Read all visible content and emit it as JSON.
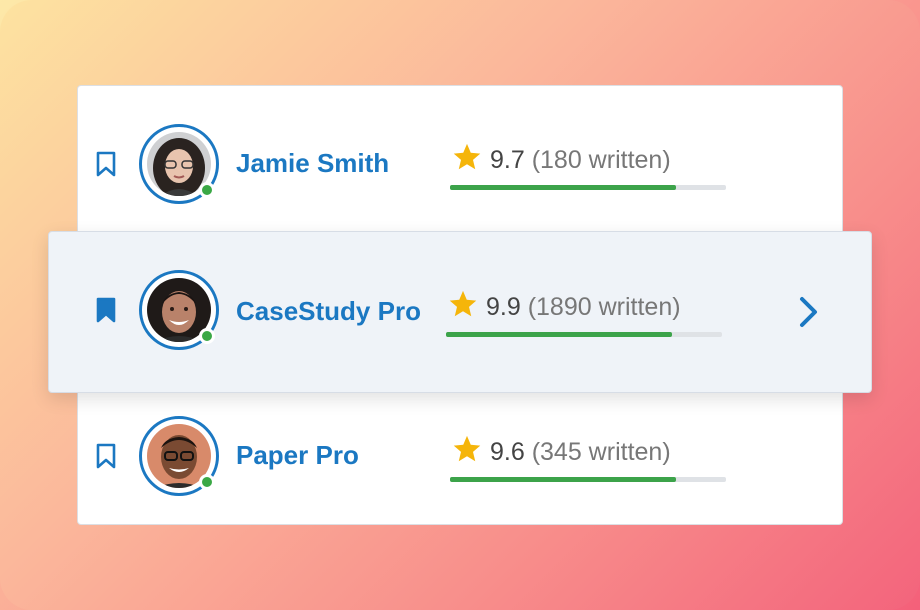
{
  "colors": {
    "accent": "#1b78c2",
    "online": "#3aa845",
    "star": "#f5b50a",
    "progress": "#3ca34a",
    "track": "#dfe2e6"
  },
  "writers": [
    {
      "name": "Jamie Smith",
      "score": "9.7",
      "written": "(180 written)",
      "bookmarked": false,
      "progress": 0.82,
      "online": true,
      "avatar_icon": "woman-with-glasses-avatar"
    },
    {
      "name": "CaseStudy Pro",
      "score": "9.9",
      "written": "(1890 written)",
      "bookmarked": true,
      "progress": 0.82,
      "online": true,
      "avatar_icon": "smiling-man-avatar",
      "selected": true
    },
    {
      "name": "Paper Pro",
      "score": "9.6",
      "written": "(345 written)",
      "bookmarked": false,
      "progress": 0.82,
      "online": true,
      "avatar_icon": "man-with-glasses-avatar"
    }
  ],
  "icons": {
    "bookmark": "bookmark-icon",
    "star": "star-icon",
    "chevron": "chevron-right-icon"
  }
}
